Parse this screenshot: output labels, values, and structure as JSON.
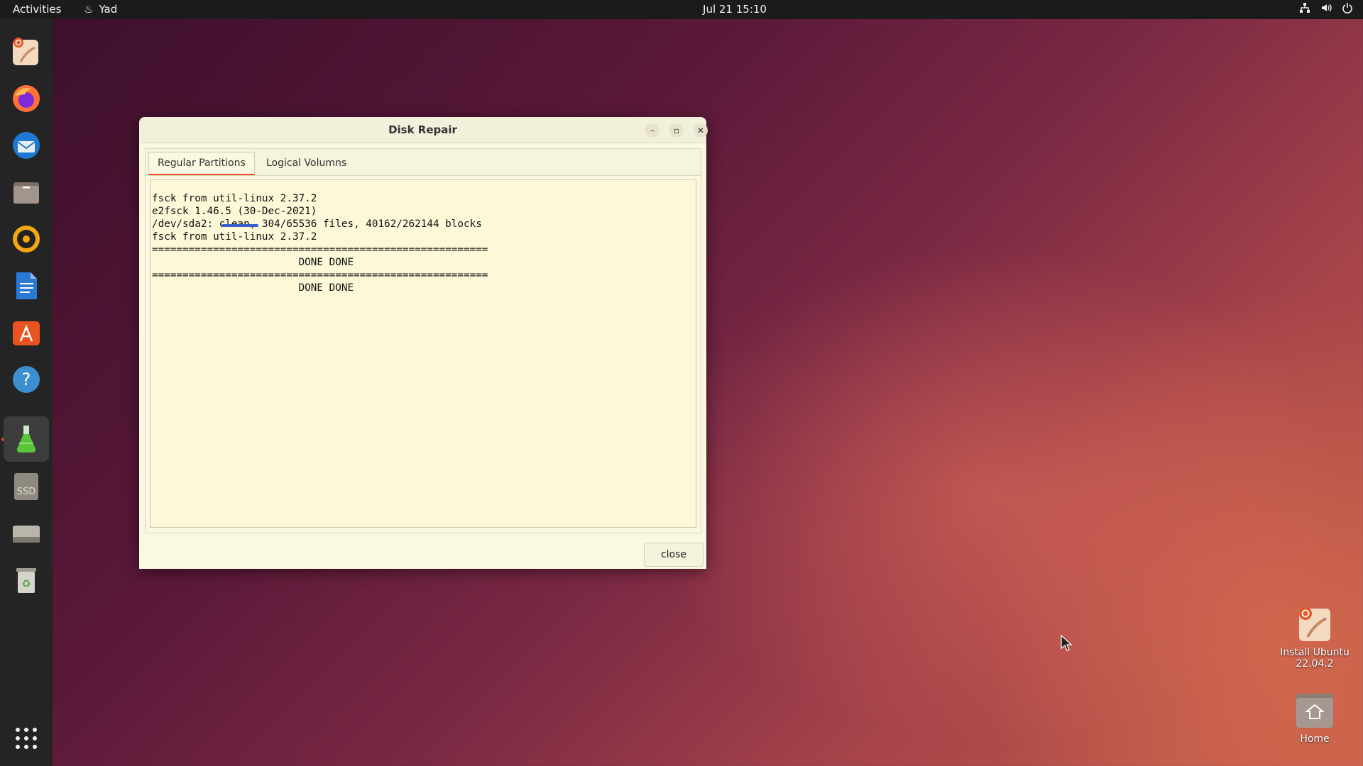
{
  "topbar": {
    "activities": "Activities",
    "app_name": "Yad",
    "clock": "Jul 21  15:10"
  },
  "dock": {
    "icons": [
      "ubuntu-installer-icon",
      "firefox-icon",
      "thunderbird-icon",
      "files-icon",
      "rhythmbox-icon",
      "writer-icon",
      "app-center-icon",
      "help-icon",
      "yad-flask-icon",
      "ssd-icon",
      "drive-icon",
      "trash-icon",
      "app-grid-icon"
    ],
    "ssd_label": "SSD"
  },
  "desktop": {
    "install_label_1": "Install Ubuntu",
    "install_label_2": "22.04.2",
    "home_label": "Home"
  },
  "window": {
    "title": "Disk Repair",
    "tabs": [
      "Regular Partitions",
      "Logical Volumns"
    ],
    "output_lines": "fsck from util-linux 2.37.2\ne2fsck 1.46.5 (30-Dec-2021)\n/dev/sda2: clean, 304/65536 files, 40162/262144 blocks\nfsck from util-linux 2.37.2\n=======================================================\n                        DONE DONE\n=======================================================\n                        DONE DONE",
    "close_label": "close"
  }
}
